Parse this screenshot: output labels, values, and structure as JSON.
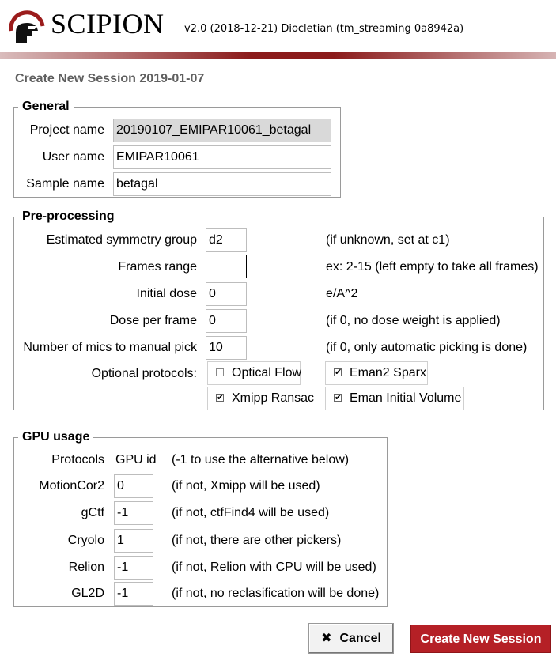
{
  "header": {
    "brand": "SCIPION",
    "version": "v2.0 (2018-12-21) Diocletian (tm_streaming 0a8942a)",
    "logo_icon": "scipion-helmet-logo",
    "accent_color": "#8b1b1b"
  },
  "session_title": "Create New Session  2019-01-07",
  "general": {
    "title": "General",
    "project_name_label": "Project name",
    "project_name_value": "20190107_EMIPAR10061_betagal",
    "user_name_label": "User name",
    "user_name_value": "EMIPAR10061",
    "sample_name_label": "Sample name",
    "sample_name_value": "betagal"
  },
  "preprocessing": {
    "title": "Pre-processing",
    "symmetry_label": "Estimated symmetry group",
    "symmetry_value": "d2",
    "symmetry_hint": "(if unknown, set at c1)",
    "frames_label": "Frames range",
    "frames_value": "",
    "frames_hint": "ex: 2-15 (left empty to take all frames)",
    "initial_dose_label": "Initial dose",
    "initial_dose_value": "0",
    "initial_dose_hint": "e/A^2",
    "dose_per_frame_label": "Dose per frame",
    "dose_per_frame_value": "0",
    "dose_per_frame_hint": "(if 0, no dose weight is applied)",
    "manual_pick_label": "Number of mics to manual pick",
    "manual_pick_value": "10",
    "manual_pick_hint": "(if 0, only automatic picking is done)",
    "optional_label": "Optional protocols:",
    "optional": [
      {
        "label": "Optical Flow",
        "checked": false
      },
      {
        "label": "Eman2 Sparx",
        "checked": true
      },
      {
        "label": "Xmipp Ransac",
        "checked": true
      },
      {
        "label": "Eman Initial Volume",
        "checked": true
      }
    ]
  },
  "gpu": {
    "title": "GPU usage",
    "col_protocols": "Protocols",
    "col_gpu_id": "GPU id",
    "col_note": "(-1 to use the alternative below)",
    "rows": [
      {
        "protocol": "MotionCor2",
        "gpu": "0",
        "note": "(if not, Xmipp will be used)"
      },
      {
        "protocol": "gCtf",
        "gpu": "-1",
        "note": "(if not, ctfFind4 will be used)"
      },
      {
        "protocol": "Cryolo",
        "gpu": "1",
        "note": "(if not, there are other pickers)"
      },
      {
        "protocol": "Relion",
        "gpu": "-1",
        "note": "(if not, Relion with CPU will be used)"
      },
      {
        "protocol": "GL2D",
        "gpu": "-1",
        "note": "(if not, no reclasification will be done)"
      }
    ]
  },
  "buttons": {
    "cancel": "Cancel",
    "cancel_icon": "close-icon",
    "create": "Create New Session",
    "create_color": "#b52026"
  }
}
